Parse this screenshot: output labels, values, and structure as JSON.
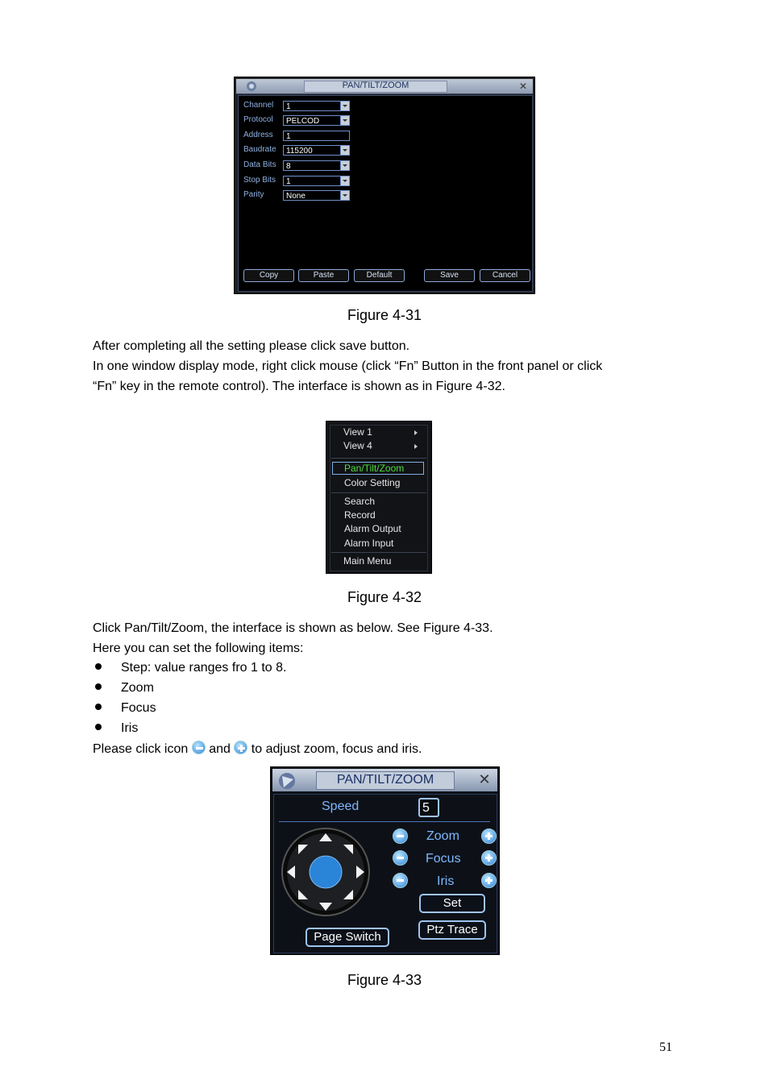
{
  "fig31": {
    "title": "PAN/TILT/ZOOM",
    "fields": [
      {
        "label": "Channel",
        "value": "1"
      },
      {
        "label": "Protocol",
        "value": "PELCOD"
      },
      {
        "label": "Address",
        "value": "1"
      },
      {
        "label": "Baudrate",
        "value": "115200"
      },
      {
        "label": "Data Bits",
        "value": "8"
      },
      {
        "label": "Stop Bits",
        "value": "1"
      },
      {
        "label": "Parity",
        "value": "None"
      }
    ],
    "buttons": {
      "copy": "Copy",
      "paste": "Paste",
      "default": "Default",
      "save": "Save",
      "cancel": "Cancel"
    },
    "caption": "Figure 4-31"
  },
  "text1": {
    "line1": "After completing all the setting please click save button.",
    "line2": "In one window display mode, right click mouse (click “Fn” Button in the front panel or click",
    "line3": "“Fn” key in the remote control). The interface is shown as in Figure 4-32."
  },
  "fig32": {
    "items": [
      "View 1",
      "View 4",
      "Pan/Tilt/Zoom",
      "Color Setting",
      "Search",
      "Record",
      "Alarm Output",
      "Alarm Input",
      "Main Menu"
    ],
    "caption": "Figure 4-32"
  },
  "text2": {
    "line1": "Click Pan/Tilt/Zoom, the interface is shown as below. See Figure 4-33.",
    "line2": "Here you can set the following items:",
    "bullets": [
      "Step: value ranges fro 1 to 8.",
      "Zoom",
      "Focus",
      "Iris"
    ],
    "icon_line_a": "Please click icon",
    "icon_line_b": "and",
    "icon_line_c": "to adjust zoom, focus and iris."
  },
  "fig33": {
    "title": "PAN/TILT/ZOOM",
    "speed_label": "Speed",
    "speed_value": "5",
    "zoom": "Zoom",
    "focus": "Focus",
    "iris": "Iris",
    "set": "Set",
    "ptz_trace": "Ptz Trace",
    "page_switch": "Page Switch",
    "caption": "Figure 4-33"
  },
  "page_number": "51"
}
